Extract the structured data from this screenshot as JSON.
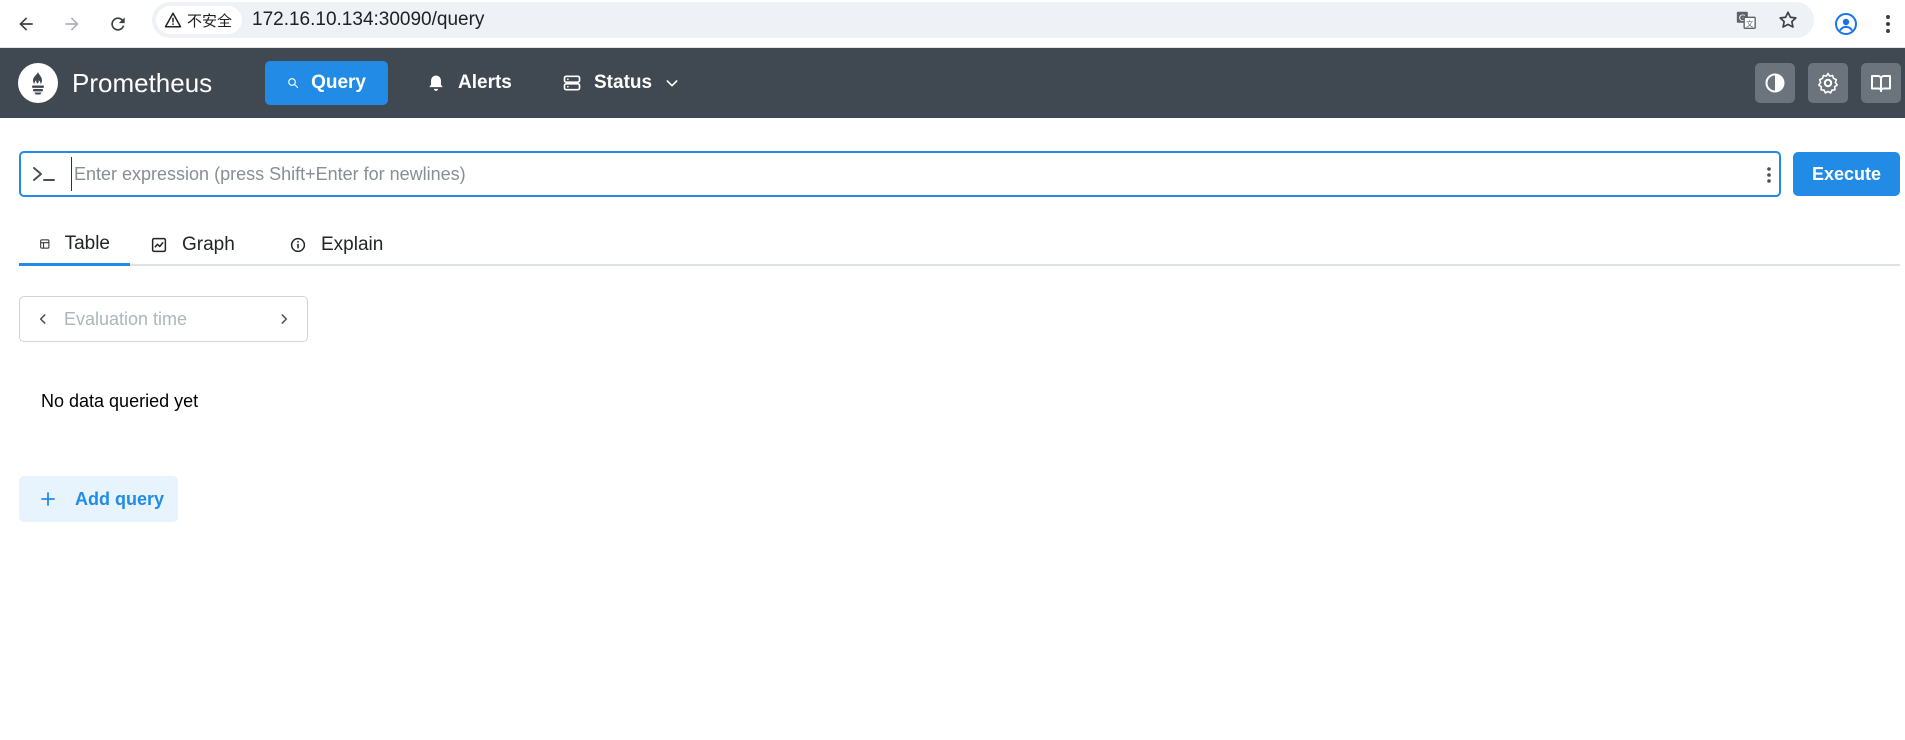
{
  "browser": {
    "security_label": "不安全",
    "url": "172.16.10.134:30090/query"
  },
  "app": {
    "brand": "Prometheus",
    "nav": {
      "query": "Query",
      "alerts": "Alerts",
      "status": "Status"
    }
  },
  "query": {
    "expression_value": "",
    "expression_placeholder": "Enter expression (press Shift+Enter for newlines)",
    "execute_label": "Execute",
    "tabs": [
      {
        "label": "Table",
        "icon": "table-icon",
        "active": true
      },
      {
        "label": "Graph",
        "icon": "graph-icon",
        "active": false
      },
      {
        "label": "Explain",
        "icon": "info-icon",
        "active": false
      }
    ],
    "eval_time_placeholder": "Evaluation time",
    "empty_message": "No data queried yet",
    "add_query_label": "Add query"
  },
  "colors": {
    "accent": "#228be6",
    "navbar": "#404852"
  }
}
